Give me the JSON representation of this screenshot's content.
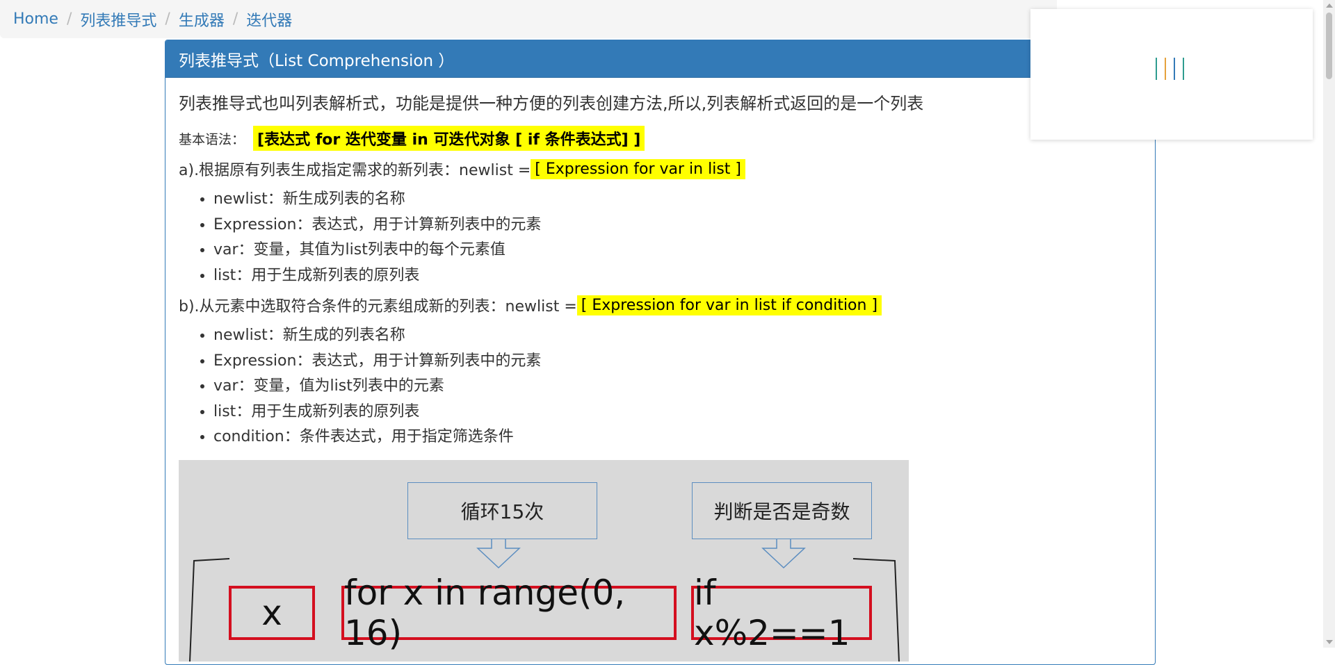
{
  "breadcrumb": {
    "items": [
      "Home",
      "列表推导式",
      "生成器",
      "迭代器"
    ],
    "separator": "/"
  },
  "panel": {
    "title": "列表推导式（List Comprehension ）",
    "intro": "列表推导式也叫列表解析式，功能是提供一种方便的列表创建方法,所以,列表解析式返回的是一个列表",
    "syntax_label": "基本语法：",
    "syntax": "[表达式 for 迭代变量 in 可迭代对象 [ if 条件表达式] ]",
    "rule_a_text": "a).根据原有列表生成指定需求的新列表：newlist = ",
    "rule_a_code": "[ Expression for var in list ]",
    "list_a": [
      "newlist：新生成列表的名称",
      "Expression：表达式，用于计算新列表中的元素",
      "var：变量，其值为list列表中的每个元素值",
      "list：用于生成新列表的原列表"
    ],
    "rule_b_text": "b).从元素中选取符合条件的元素组成新的列表：newlist = ",
    "rule_b_code": "[ Expression for var in list if condition ]",
    "list_b": [
      "newlist：新生成的列表名称",
      "Expression：表达式，用于计算新列表中的元素",
      "var：变量，值为list列表中的元素",
      "list：用于生成新列表的原列表",
      "condition：条件表达式，用于指定筛选条件"
    ]
  },
  "diagram": {
    "callout_loop": "循环15次",
    "callout_odd": "判断是否是奇数",
    "box_x": "x",
    "box_for": "for x in range(0, 16)",
    "box_if": "if x%2==1"
  },
  "colors": {
    "primary": "#337ab7",
    "highlight": "#ffff00",
    "red_box": "#d40f1f",
    "loader": [
      "#2e9c8f",
      "#e6a23c",
      "#337ab7",
      "#2e9c8f"
    ]
  }
}
